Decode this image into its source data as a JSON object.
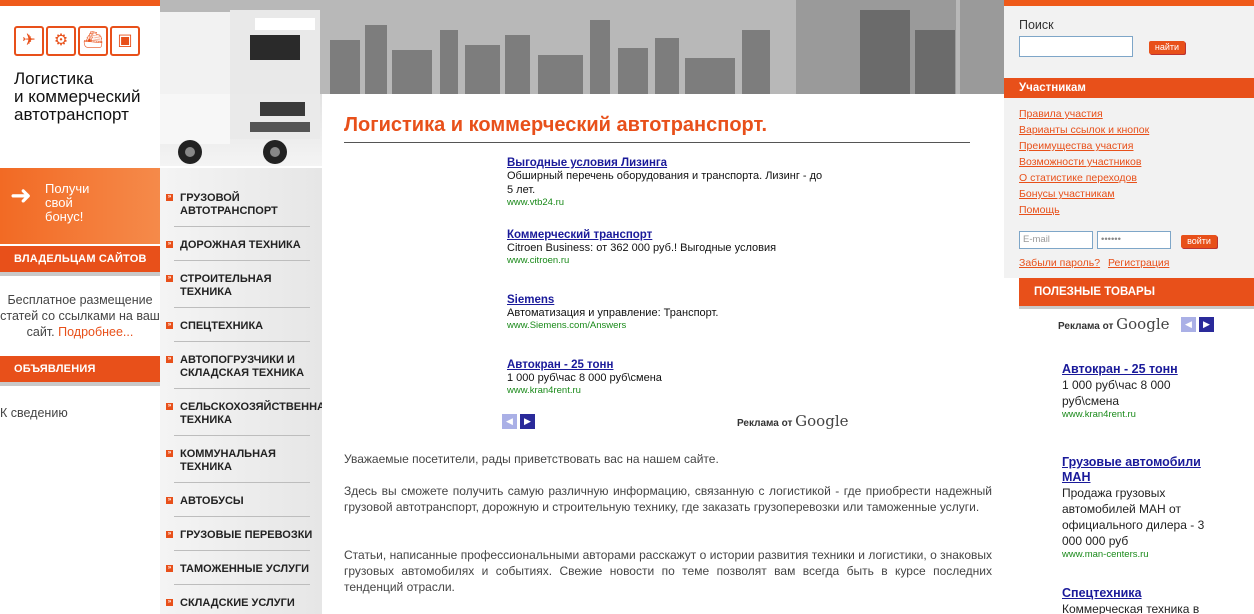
{
  "logo": {
    "line1": "Логистика",
    "line2": "и коммерческий",
    "line3": "автотранспорт",
    "icons": [
      "airplane-icon",
      "forklift-icon",
      "ship-icon",
      "train-icon"
    ]
  },
  "bonus": {
    "line1": "Получи",
    "line2": "свой",
    "line3": "бонус!"
  },
  "site_owners": {
    "header": "ВЛАДЕЛЬЦАМ САЙТОВ",
    "text": "Бесплатное размещение статей со ссылками на ваш сайт.",
    "more": "Подробнее..."
  },
  "announcements": {
    "header": "ОБЪЯВЛЕНИЯ",
    "item": "К сведению"
  },
  "nav": {
    "items": [
      {
        "label": "ГРУЗОВОЙ",
        "label2": "АВТОТРАНСПОРТ"
      },
      {
        "label": "ДОРОЖНАЯ ТЕХНИКА",
        "label2": ""
      },
      {
        "label": "СТРОИТЕЛЬНАЯ",
        "label2": "ТЕХНИКА"
      },
      {
        "label": "СПЕЦТЕХНИКА",
        "label2": ""
      },
      {
        "label": "АВТОПОГРУЗЧИКИ И",
        "label2": "СКЛАДСКАЯ ТЕХНИКА"
      },
      {
        "label": "СЕЛЬСКОХОЗЯЙСТВЕННАЯ",
        "label2": "ТЕХНИКА"
      },
      {
        "label": "КОММУНАЛЬНАЯ",
        "label2": "ТЕХНИКА"
      },
      {
        "label": "АВТОБУСЫ",
        "label2": ""
      },
      {
        "label": "ГРУЗОВЫЕ ПЕРЕВОЗКИ",
        "label2": ""
      },
      {
        "label": "ТАМОЖЕННЫЕ УСЛУГИ",
        "label2": ""
      },
      {
        "label": "СКЛАДСКИЕ УСЛУГИ",
        "label2": ""
      }
    ]
  },
  "main": {
    "title": "Логистика и коммерческий автотранспорт.",
    "ads": [
      {
        "title": "Выгодные условия Лизинга",
        "desc": "Обширный перечень оборудования и транспорта. Лизинг - до 5 лет.",
        "url": "www.vtb24.ru"
      },
      {
        "title": "Коммерческий транспорт",
        "desc": "Citroen Business: от 362 000 руб.! Выгодные условия",
        "url": "www.citroen.ru"
      },
      {
        "title": "Siemens",
        "desc": "Автоматизация и управление: Транспорт.",
        "url": "www.Siemens.com/Answers"
      },
      {
        "title": "Автокран - 25 тонн",
        "desc": "1 000 руб\\час 8 000 руб\\смена",
        "url": "www.kran4rent.ru"
      }
    ],
    "google_ads": {
      "prefix": "Реклама от",
      "brand": "Google"
    },
    "paragraphs": [
      "Уважаемые посетители, рады приветствовать вас на нашем сайте.",
      "Здесь вы сможете получить самую различную информацию, связанную с логистикой - где приобрести надежный грузовой автотранспорт, дорожную и строительную технику, где заказать грузоперевозки или таможенные услуги.",
      "Статьи, написанные профессиональными авторами расскажут о истории развития техники и логистики, о знаковых грузовых автомобилях и событиях. Свежие новости по теме позволят вам всегда быть в курсе последних тенденций отрасли."
    ]
  },
  "search": {
    "label": "Поиск",
    "button": "найти",
    "value": ""
  },
  "members": {
    "header": "Участникам",
    "links": [
      "Правила участия",
      "Варианты ссылок и кнопок",
      "Преимущества участия",
      "Возможности участников",
      "О статистике переходов",
      "Бонусы участникам",
      "Помощь"
    ],
    "email_placeholder": "E-mail",
    "password_value": "••••••",
    "login_button": "войти",
    "forgot": "Забыли пароль?",
    "register": "Регистрация"
  },
  "products": {
    "header": "ПОЛЕЗНЫЕ ТОВАРЫ",
    "google_prefix": "Реклама от",
    "google_brand": "Google",
    "ads": [
      {
        "title": "Автокран - 25 тонн",
        "desc": "1 000 руб\\час 8 000 руб\\смена",
        "url": "www.kran4rent.ru"
      },
      {
        "title": "Грузовые автомобили МАН",
        "desc": "Продажа грузовых автомобилей МАН от официального дилера - 3 000 000 руб",
        "url": "www.man-centers.ru"
      },
      {
        "title": "Спецтехника",
        "desc": "Коммерческая техника в",
        "url": ""
      }
    ]
  },
  "colors": {
    "accent": "#e8501a",
    "link": "#1a1a9a",
    "url": "#1a8a1a"
  }
}
